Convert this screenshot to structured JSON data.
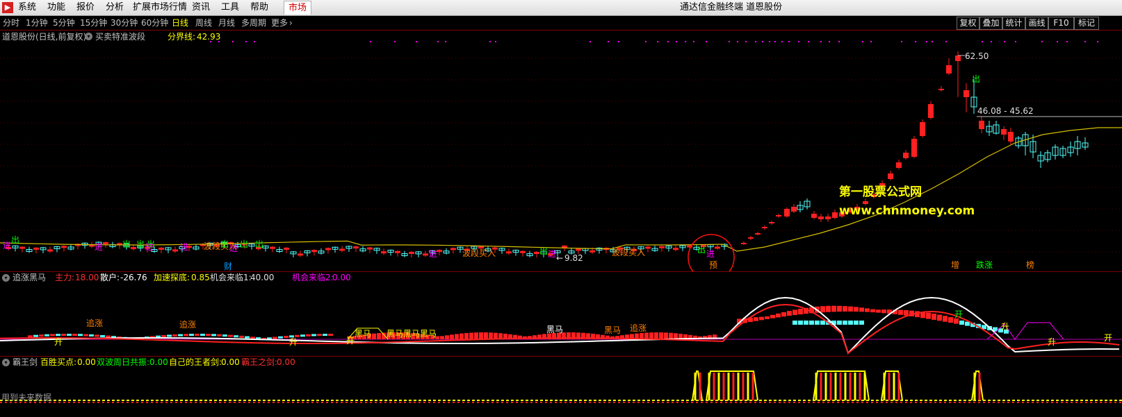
{
  "menubar": {
    "items": [
      "系统",
      "功能",
      "报价",
      "分析",
      "扩展市场行情",
      "资讯",
      "工具",
      "帮助"
    ],
    "market_tab": "市场",
    "title": "通达信金融终端  道恩股份"
  },
  "toolbar": {
    "periods": [
      "分时",
      "1分钟",
      "5分钟",
      "15分钟",
      "30分钟",
      "60分钟",
      "日线",
      "周线",
      "月线",
      "多周期",
      "更多"
    ],
    "active_period": "日线",
    "more_arrow": "›",
    "buttons": [
      "复权",
      "叠加",
      "统计",
      "画线",
      "F10",
      "标记"
    ]
  },
  "main_chart": {
    "stock_label": "道恩股份(日线,前复权)",
    "indicator_name": "买卖特准波段",
    "boundary_label": "分界线:",
    "boundary_value": "42.93",
    "high_label": "62.50",
    "low_label": "9.82",
    "range_label": "46.08 - 45.62",
    "markers": [
      "进",
      "出",
      "进",
      "出",
      "出",
      "出",
      "进",
      "进",
      "波段买入",
      "出",
      "出",
      "进",
      "出",
      "财",
      "波段买入",
      "进",
      "出",
      "进",
      "波段买入",
      "出",
      "进",
      "预",
      "增",
      "出",
      "跌涨",
      "榜"
    ]
  },
  "watermark": {
    "line1": "第一股票公式网",
    "line2": "www.chnmoney.com"
  },
  "indicator1": {
    "name": "追涨黑马",
    "values": [
      {
        "label": "主力:",
        "value": "18.00",
        "color": "#ff3030"
      },
      {
        "label": "散户:",
        "value": "-26.76",
        "color": "#ffffff"
      },
      {
        "label": "加速探底:",
        "value": "0.85",
        "color": "#ffff00"
      },
      {
        "label": "机会来临1:",
        "value": "40.00",
        "color": "#e0e0e0"
      },
      {
        "label": "机会来临2:",
        "value": "0.00",
        "color": "#ff00ff"
      }
    ],
    "markers": [
      "追涨",
      "追涨",
      "升",
      "升",
      "开",
      "黑马",
      "黑马黑马黑马",
      "黑马",
      "黑马",
      "追涨",
      "开",
      "升",
      "升",
      "开"
    ]
  },
  "indicator2": {
    "name": "霸王剑",
    "values": [
      {
        "label": "百胜买点:",
        "value": "0.00",
        "color": "#ffff00"
      },
      {
        "label": "双波周日共振:",
        "value": "0.00",
        "color": "#00ff00"
      },
      {
        "label": "自己的王者剑:",
        "value": "0.00",
        "color": "#ffff00"
      },
      {
        "label": "霸王之剑:",
        "value": "0.00",
        "color": "#ff3030"
      }
    ],
    "note": "用到未来数据"
  },
  "colors": {
    "up": "#ff2020",
    "down": "#54ffff",
    "ma": "#d8c000",
    "bg": "#000000"
  }
}
